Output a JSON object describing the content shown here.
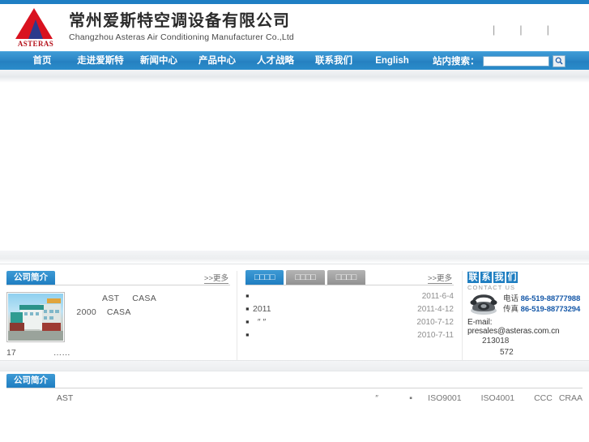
{
  "site": {
    "logo_text": "ASTERAS",
    "title_cn": "常州爱斯特空调设备有限公司",
    "title_en": "Changzhou Asteras Air Conditioning Manufacturer Co.,Ltd"
  },
  "top_links": {
    "sep": "|",
    "link1": "",
    "link2": "",
    "link3": ""
  },
  "nav": {
    "items": [
      {
        "label": "首页"
      },
      {
        "label": "走进爱斯特"
      },
      {
        "label": "新闻中心"
      },
      {
        "label": "产品中心"
      },
      {
        "label": "人才战略"
      },
      {
        "label": "联系我们"
      },
      {
        "label": "English"
      }
    ],
    "search_label": "站内搜索：",
    "search_value": "",
    "search_placeholder": "",
    "search_icon": "search-icon"
  },
  "about": {
    "heading": "公司简介",
    "more": ">>更多",
    "photo_alt": "company-building-photo",
    "line1": "            AST     CASA",
    "line2": "  2000    CASA",
    "foot_num": "17",
    "foot_dots": "……"
  },
  "news": {
    "tabs": [
      {
        "label": "□□□□",
        "active": true
      },
      {
        "label": "□□□□",
        "active": false
      },
      {
        "label": "□□□□",
        "active": false
      }
    ],
    "more": ">>更多",
    "items": [
      {
        "bullet": "▪",
        "title": "",
        "date": "2011-6-4"
      },
      {
        "bullet": "▪",
        "title": "2011",
        "date": "2011-4-12"
      },
      {
        "bullet": "▪",
        "title": "  ″ ″",
        "date": "2010-7-12"
      },
      {
        "bullet": "▪",
        "title": "",
        "date": "2010-7-11"
      }
    ]
  },
  "contact": {
    "title_chars": [
      "联",
      "系",
      "我",
      "们"
    ],
    "subtitle": "CONTACT US",
    "phone_icon": "telephone-icon",
    "phone_label": "电话",
    "phone_number": "86-519-88777988",
    "fax_label": "传真",
    "fax_number": "86-519-88773294",
    "email": "E-mail: presales@asteras.com.cn",
    "postcode": "213018",
    "extra": "572"
  },
  "bottom": {
    "heading": "公司简介",
    "text": "      AST",
    "dot1": "″",
    "dot2": "▪",
    "certs": [
      "ISO9001",
      "ISO4001",
      "CCC",
      "CRAA"
    ]
  },
  "colors": {
    "accent": "#1f7ec1",
    "nav_blue": "#2a86c6",
    "logo_red": "#d9121f",
    "logo_navy": "#2c3a8c",
    "link_blue": "#1558a8"
  }
}
